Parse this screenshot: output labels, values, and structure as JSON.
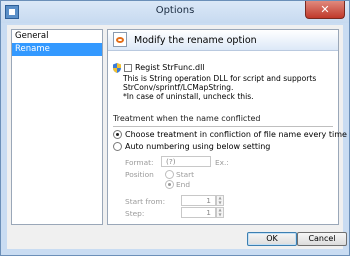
{
  "window": {
    "title": "Options",
    "close_symbol": "✕"
  },
  "nav": {
    "items": [
      {
        "label": "General",
        "selected": false
      },
      {
        "label": "Rename",
        "selected": true
      }
    ]
  },
  "panel": {
    "header_title": "Modify the rename option",
    "regist": {
      "label": "Regist StrFunc.dll",
      "checked": false
    },
    "description": [
      "This is String operation DLL for script and supports",
      "StrConv/sprintf/LCMapString.",
      "*In case of uninstall, uncheck this."
    ],
    "conflict_group_label": "Treatment when the name conflicted",
    "options": [
      {
        "label": "Choose treatment in confliction of file name every time",
        "checked": true
      },
      {
        "label": "Auto numbering using below setting",
        "checked": false
      }
    ],
    "format": {
      "label": "Format:",
      "value": "(?)",
      "example_label": "Ex.:"
    },
    "position": {
      "label": "Position",
      "start_label": "Start",
      "end_label": "End",
      "selected": "End"
    },
    "start_from": {
      "label": "Start from:",
      "value": "1"
    },
    "step": {
      "label": "Step:",
      "value": "1"
    }
  },
  "buttons": {
    "ok": "OK",
    "cancel": "Cancel"
  }
}
